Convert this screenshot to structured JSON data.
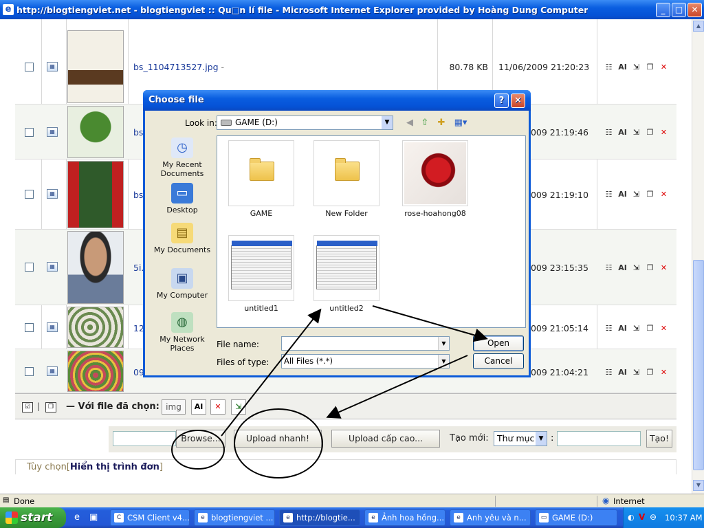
{
  "window": {
    "title": "http://blogtiengviet.net - blogtiengviet :: Qu□n lí file - Microsoft Internet Explorer provided by Hoàng Dung Computer",
    "min_glyph": "_",
    "max_glyph": "□",
    "close_glyph": "✕"
  },
  "files": [
    {
      "name": "bs_1104713527.jpg",
      "suffix": "-",
      "size": "80.78 KB",
      "date": "11/06/2009 21:20:23"
    },
    {
      "name": "bs",
      "size": "",
      "date": "2009 21:19:46"
    },
    {
      "name": "bs",
      "size": "",
      "date": "2009 21:19:10"
    },
    {
      "name": "5i.",
      "size": "",
      "date": "2009 23:15:35"
    },
    {
      "name": "12",
      "size": "",
      "date": "2009 21:05:14"
    },
    {
      "name": "09",
      "size": "",
      "date": "2009 21:04:21"
    }
  ],
  "action_icons": {
    "edit": "☷",
    "rename": "AI",
    "move": "⇲",
    "copy": "❐",
    "delete": "✕"
  },
  "selected_bar": {
    "label": "— Với file đã chọn:",
    "prefix_value": "img",
    "rename_glyph": "AI",
    "delete_glyph": "✕",
    "other_glyph": "⇲",
    "divider": "|"
  },
  "upload_bar": {
    "browse_label": "Browse...",
    "quick_upload_label": "Upload nhanh!",
    "advanced_upload_label": "Upload cấp cao...",
    "new_label": "Tạo mới:",
    "new_type_value": "Thư mục",
    "colon": ":",
    "create_label": "Tạo!"
  },
  "options": {
    "prefix": "Tùy chọn[",
    "link": "Hiển thị trình đơn",
    "suffix": "]"
  },
  "status": {
    "text": "Done",
    "zone": "Internet"
  },
  "taskbar": {
    "start": "start",
    "items": [
      {
        "label": "CSM Client v4..."
      },
      {
        "label": "blogtiengviet ..."
      },
      {
        "label": "http://blogtie..."
      },
      {
        "label": "Ảnh hoa hồng..."
      },
      {
        "label": "Anh yêu và n..."
      },
      {
        "label": "GAME (D:)"
      }
    ],
    "clock": "10:37 AM"
  },
  "dialog": {
    "title": "Choose file",
    "help_glyph": "?",
    "close_glyph": "✕",
    "look_in_label": "Look in:",
    "look_in_value": "GAME (D:)",
    "places": [
      {
        "label": "My Recent Documents",
        "icon": "recent-documents-icon"
      },
      {
        "label": "Desktop",
        "icon": "desktop-icon"
      },
      {
        "label": "My Documents",
        "icon": "my-documents-icon"
      },
      {
        "label": "My Computer",
        "icon": "my-computer-icon"
      },
      {
        "label": "My Network Places",
        "icon": "network-places-icon"
      }
    ],
    "items": [
      {
        "name": "GAME",
        "kind": "folder"
      },
      {
        "name": "New Folder",
        "kind": "folder"
      },
      {
        "name": "rose-hoahong08",
        "kind": "image"
      },
      {
        "name": "untitled1",
        "kind": "screenshot"
      },
      {
        "name": "untitled2",
        "kind": "screenshot"
      }
    ],
    "file_name_label": "File name:",
    "file_name_value": "",
    "files_of_type_label": "Files of type:",
    "files_of_type_value": "All Files (*.*)",
    "open_label": "Open",
    "cancel_label": "Cancel"
  },
  "colors": {
    "accent": "#0a5ee0",
    "link": "#1a3a9a",
    "delete": "#d00000"
  }
}
